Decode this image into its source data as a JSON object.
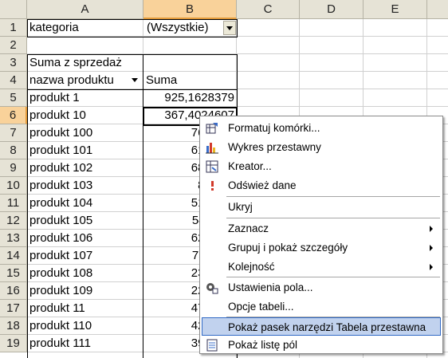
{
  "columns": [
    "A",
    "B",
    "C",
    "D",
    "E"
  ],
  "rows": [
    "1",
    "2",
    "3",
    "4",
    "5",
    "6",
    "7",
    "8",
    "9",
    "10",
    "11",
    "12",
    "13",
    "14",
    "15",
    "16",
    "17",
    "18",
    "19"
  ],
  "page_field": {
    "label": "kategoria",
    "value": "(Wszystkie)"
  },
  "data_title": "Suma z sprzedaż",
  "row_field_label": "nazwa produktu",
  "sum_header": "Suma",
  "pivot_rows": [
    {
      "name": "produkt 1",
      "value": "925,1628379"
    },
    {
      "name": "produkt 10",
      "value": "367,4024607"
    },
    {
      "name": "produkt 100",
      "value": "766,460"
    },
    {
      "name": "produkt 101",
      "value": "619,233"
    },
    {
      "name": "produkt 102",
      "value": "689,916"
    },
    {
      "name": "produkt 103",
      "value": "882,22"
    },
    {
      "name": "produkt 104",
      "value": "513,932"
    },
    {
      "name": "produkt 105",
      "value": "546,117"
    },
    {
      "name": "produkt 106",
      "value": "629,317"
    },
    {
      "name": "produkt 107",
      "value": "738,114"
    },
    {
      "name": "produkt 108",
      "value": "232,255"
    },
    {
      "name": "produkt 109",
      "value": "229,423"
    },
    {
      "name": "produkt 11",
      "value": "470,893"
    },
    {
      "name": "produkt 110",
      "value": "429,409"
    },
    {
      "name": "produkt 111",
      "value": "399,469"
    }
  ],
  "context_menu": {
    "items": [
      {
        "label": "Formatuj komórki...",
        "icon": "format-cells-icon"
      },
      {
        "label": "Wykres przestawny",
        "icon": "pivot-chart-icon"
      },
      {
        "label": "Kreator...",
        "icon": "wizard-icon"
      },
      {
        "label": "Odśwież dane",
        "icon": "refresh-icon"
      },
      {
        "label": "Ukryj",
        "icon": ""
      },
      {
        "label": "Zaznacz",
        "icon": "",
        "submenu": true
      },
      {
        "label": "Grupuj i pokaż szczegóły",
        "icon": "",
        "submenu": true
      },
      {
        "label": "Kolejność",
        "icon": "",
        "submenu": true
      },
      {
        "label": "Ustawienia pola...",
        "icon": "field-settings-icon"
      },
      {
        "label": "Opcje tabeli...",
        "icon": ""
      },
      {
        "label": "Pokaż pasek narzędzi Tabela przestawna",
        "icon": "",
        "highlighted": true
      },
      {
        "label": "Pokaż listę pól",
        "icon": "field-list-icon"
      }
    ]
  },
  "colors": {
    "header_bg": "#e6e3d6",
    "selected_header": "#f9d29a",
    "menu_highlight": "#c1d2ee"
  }
}
